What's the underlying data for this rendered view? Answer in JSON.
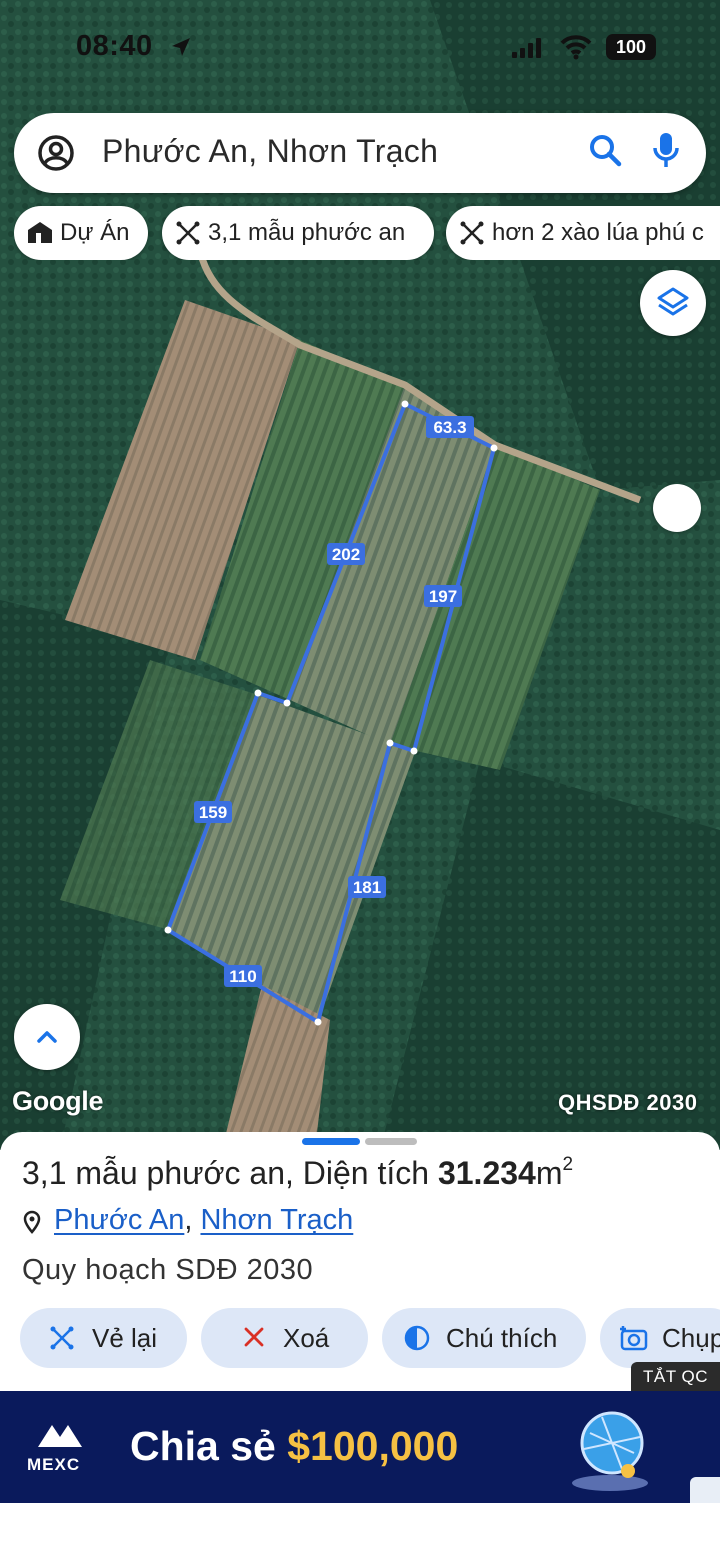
{
  "status_bar": {
    "time": "08:40",
    "battery": "100"
  },
  "search": {
    "query": "Phước An, Nhơn Trạch"
  },
  "chips": [
    {
      "label": "Dự Án",
      "icon": "house-icon"
    },
    {
      "label": "3,1 mẫu phước an",
      "icon": "measure-icon"
    },
    {
      "label": "hơn 2 xào lúa phú c",
      "icon": "measure-icon"
    }
  ],
  "map": {
    "attribution": "Google",
    "plan_layer": "QHSDĐ 2030",
    "parcel_edge_labels": [
      "63.3",
      "202",
      "197",
      "159",
      "181",
      "110"
    ],
    "parcel_color": "#3b6fe0"
  },
  "sheet": {
    "title_name": "3,1 mẫu phước an",
    "title_sep": ", ",
    "title_area_label": "Diện tích ",
    "title_area_value": "31.234",
    "title_area_unit": "m",
    "title_area_exp": "2",
    "location_ward": "Phước An",
    "location_sep": ", ",
    "location_district": "Nhơn Trạch",
    "subtitle": "Quy hoạch SDĐ 2030",
    "actions": [
      {
        "label": "Vẻ lại",
        "icon": "measure-icon"
      },
      {
        "label": "Xoá",
        "icon": "close-icon"
      },
      {
        "label": "Chú thích",
        "icon": "contrast-icon"
      },
      {
        "label": "Chụp",
        "icon": "camera-icon"
      }
    ]
  },
  "ad": {
    "close_label": "TẮT QC",
    "brand": "MEXC",
    "headline_text": "Chia sẻ ",
    "headline_amount": "$100,000"
  }
}
